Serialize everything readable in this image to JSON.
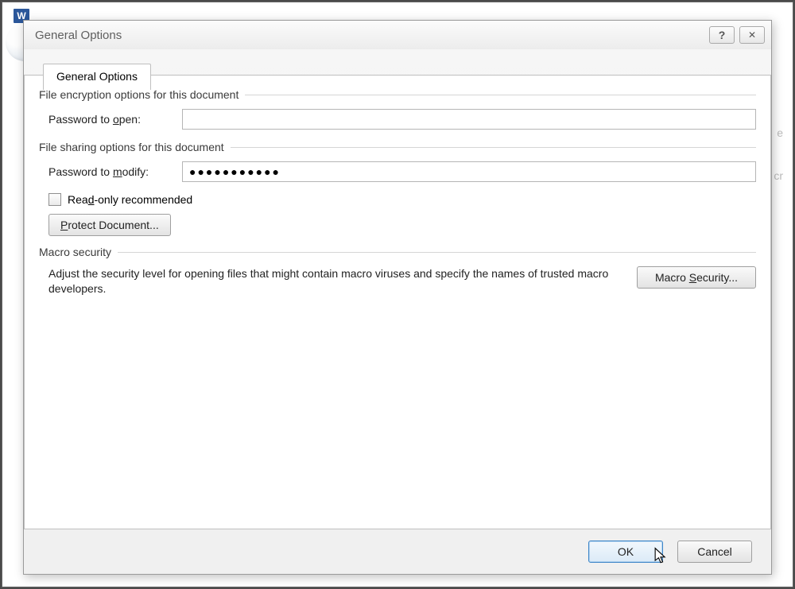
{
  "titlebar": {
    "title": "General Options",
    "help_label": "?",
    "close_label": "✕"
  },
  "tab": {
    "label": "General Options"
  },
  "groups": {
    "encryption": {
      "title": "File encryption options for this document",
      "password_open": {
        "label_pre": "Password to ",
        "label_u": "o",
        "label_post": "pen:",
        "value": ""
      }
    },
    "sharing": {
      "title": "File sharing options for this document",
      "password_modify": {
        "label_pre": "Password to ",
        "label_u": "m",
        "label_post": "odify:",
        "value": "●●●●●●●●●●●"
      },
      "readonly": {
        "label_pre": "Rea",
        "label_u": "d",
        "label_post": "-only recommended",
        "checked": false
      },
      "protect_btn": {
        "label_u": "P",
        "label_post": "rotect Document..."
      }
    },
    "macro": {
      "title": "Macro security",
      "text": "Adjust the security level for opening files that might contain macro viruses and specify the names of trusted macro developers.",
      "btn": {
        "label_pre": "Macro ",
        "label_u": "S",
        "label_post": "ecurity..."
      }
    }
  },
  "footer": {
    "ok": "OK",
    "cancel": "Cancel"
  },
  "bg": {
    "word_icon": "W",
    "letter1": "e",
    "letter2": "cr"
  }
}
